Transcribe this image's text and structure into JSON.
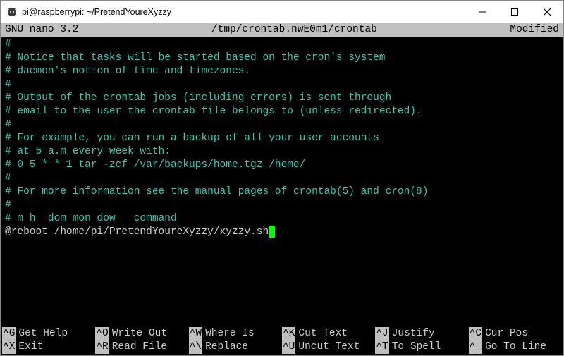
{
  "window": {
    "title": "pi@raspberrypi: ~/PretendYoureXyzzy"
  },
  "nano": {
    "version": "GNU nano 3.2",
    "filepath": "/tmp/crontab.nwE0m1/crontab",
    "status": "Modified"
  },
  "lines": [
    {
      "style": "comment",
      "text": "#"
    },
    {
      "style": "comment",
      "text": "# Notice that tasks will be started based on the cron's system"
    },
    {
      "style": "comment",
      "text": "# daemon's notion of time and timezones."
    },
    {
      "style": "comment",
      "text": "#"
    },
    {
      "style": "comment",
      "text": "# Output of the crontab jobs (including errors) is sent through"
    },
    {
      "style": "comment",
      "text": "# email to the user the crontab file belongs to (unless redirected)."
    },
    {
      "style": "comment",
      "text": "#"
    },
    {
      "style": "comment",
      "text": "# For example, you can run a backup of all your user accounts"
    },
    {
      "style": "comment",
      "text": "# at 5 a.m every week with:"
    },
    {
      "style": "comment",
      "text": "# 0 5 * * 1 tar -zcf /var/backups/home.tgz /home/"
    },
    {
      "style": "comment",
      "text": "#"
    },
    {
      "style": "comment",
      "text": "# For more information see the manual pages of crontab(5) and cron(8)"
    },
    {
      "style": "comment",
      "text": "#"
    },
    {
      "style": "comment",
      "text": "# m h  dom mon dow   command"
    },
    {
      "style": "plain",
      "text": "@reboot /home/pi/PretendYoureXyzzy/xyzzy.sh",
      "cursor": true
    }
  ],
  "shortcuts": {
    "row1": [
      {
        "key": "^G",
        "label": "Get Help"
      },
      {
        "key": "^O",
        "label": "Write Out"
      },
      {
        "key": "^W",
        "label": "Where Is"
      },
      {
        "key": "^K",
        "label": "Cut Text"
      },
      {
        "key": "^J",
        "label": "Justify"
      },
      {
        "key": "^C",
        "label": "Cur Pos"
      }
    ],
    "row2": [
      {
        "key": "^X",
        "label": "Exit"
      },
      {
        "key": "^R",
        "label": "Read File"
      },
      {
        "key": "^\\",
        "label": "Replace"
      },
      {
        "key": "^U",
        "label": "Uncut Text"
      },
      {
        "key": "^T",
        "label": "To Spell"
      },
      {
        "key": "^_",
        "label": "Go To Line"
      }
    ]
  }
}
